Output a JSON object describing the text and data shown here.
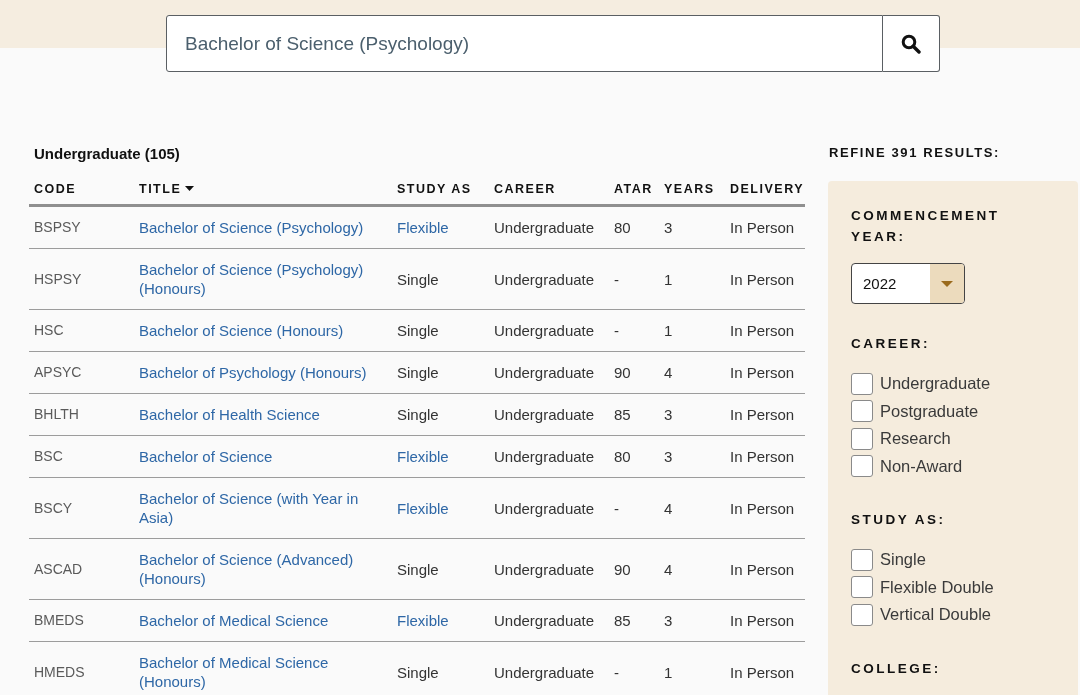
{
  "search": {
    "value": "Bachelor of Science (Psychology)"
  },
  "results": {
    "heading": "Undergraduate (105)",
    "columns": [
      {
        "label": "CODE",
        "sorted": false
      },
      {
        "label": "TITLE",
        "sorted": true
      },
      {
        "label": "STUDY AS",
        "sorted": false
      },
      {
        "label": "CAREER",
        "sorted": false
      },
      {
        "label": "ATAR",
        "sorted": false
      },
      {
        "label": "YEARS",
        "sorted": false
      },
      {
        "label": "DELIVERY",
        "sorted": false
      }
    ],
    "rows": [
      {
        "code": "BSPSY",
        "title": "Bachelor of Science (Psychology)",
        "study_as": {
          "text": "Flexible",
          "kind": "link"
        },
        "career": "Undergraduate",
        "atar": "80",
        "years": "3",
        "delivery": "In Person"
      },
      {
        "code": "HSPSY",
        "title": "Bachelor of Science (Psychology) (Honours)",
        "study_as": {
          "text": "Single",
          "kind": "plain"
        },
        "career": "Undergraduate",
        "atar": "-",
        "years": "1",
        "delivery": "In Person"
      },
      {
        "code": "HSC",
        "title": "Bachelor of Science (Honours)",
        "study_as": {
          "text": "Single",
          "kind": "plain"
        },
        "career": "Undergraduate",
        "atar": "-",
        "years": "1",
        "delivery": "In Person"
      },
      {
        "code": "APSYC",
        "title": "Bachelor of Psychology (Honours)",
        "study_as": {
          "text": "Single",
          "kind": "plain"
        },
        "career": "Undergraduate",
        "atar": "90",
        "years": "4",
        "delivery": "In Person"
      },
      {
        "code": "BHLTH",
        "title": "Bachelor of Health Science",
        "study_as": {
          "text": "Single",
          "kind": "plain"
        },
        "career": "Undergraduate",
        "atar": "85",
        "years": "3",
        "delivery": "In Person"
      },
      {
        "code": "BSC",
        "title": "Bachelor of Science",
        "study_as": {
          "text": "Flexible",
          "kind": "link"
        },
        "career": "Undergraduate",
        "atar": "80",
        "years": "3",
        "delivery": "In Person"
      },
      {
        "code": "BSCY",
        "title": "Bachelor of Science (with Year in Asia)",
        "study_as": {
          "text": "Flexible",
          "kind": "link"
        },
        "career": "Undergraduate",
        "atar": "-",
        "years": "4",
        "delivery": "In Person"
      },
      {
        "code": "ASCAD",
        "title": "Bachelor of Science (Advanced) (Honours)",
        "study_as": {
          "text": "Single",
          "kind": "plain"
        },
        "career": "Undergraduate",
        "atar": "90",
        "years": "4",
        "delivery": "In Person"
      },
      {
        "code": "BMEDS",
        "title": "Bachelor of Medical Science",
        "study_as": {
          "text": "Flexible",
          "kind": "link"
        },
        "career": "Undergraduate",
        "atar": "85",
        "years": "3",
        "delivery": "In Person"
      },
      {
        "code": "HMEDS",
        "title": "Bachelor of Medical Science (Honours)",
        "study_as": {
          "text": "Single",
          "kind": "plain"
        },
        "career": "Undergraduate",
        "atar": "-",
        "years": "1",
        "delivery": "In Person"
      }
    ]
  },
  "refine": {
    "heading": "REFINE 391 RESULTS:",
    "filters": [
      {
        "kind": "select",
        "heading": "COMMENCEMENT YEAR:",
        "value": "2022"
      },
      {
        "kind": "checkboxes",
        "heading": "CAREER:",
        "options": [
          {
            "label": "Undergraduate",
            "checked": false
          },
          {
            "label": "Postgraduate",
            "checked": false
          },
          {
            "label": "Research",
            "checked": false
          },
          {
            "label": "Non-Award",
            "checked": false
          }
        ]
      },
      {
        "kind": "checkboxes",
        "heading": "STUDY AS:",
        "options": [
          {
            "label": "Single",
            "checked": false
          },
          {
            "label": "Flexible Double",
            "checked": false
          },
          {
            "label": "Vertical Double",
            "checked": false
          }
        ]
      },
      {
        "kind": "checkboxes",
        "heading": "COLLEGE:"
      }
    ]
  }
}
